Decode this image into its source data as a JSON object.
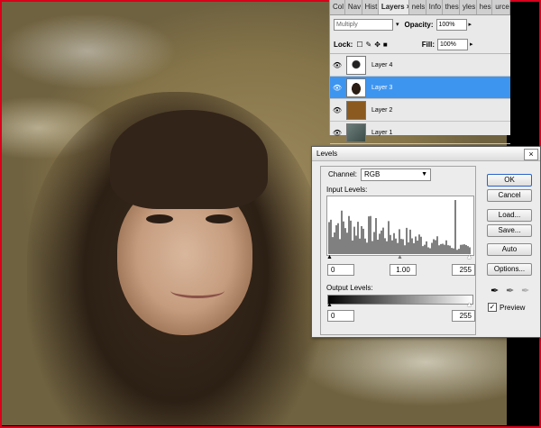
{
  "layers_panel": {
    "tabs": [
      "Col",
      "Nav",
      "Hist",
      "Layers",
      "nels",
      "Info",
      "thes",
      "yles",
      "hes",
      "urce"
    ],
    "active_tab": "Layers",
    "blend_mode": "Multiply",
    "opacity_label": "Opacity:",
    "opacity_value": "100%",
    "lock_label": "Lock:",
    "fill_label": "Fill:",
    "fill_value": "100%",
    "layers": [
      {
        "name": "Layer 4",
        "selected": false
      },
      {
        "name": "Layer 3",
        "selected": true
      },
      {
        "name": "Layer 2",
        "selected": false
      },
      {
        "name": "Layer 1",
        "selected": false
      }
    ]
  },
  "levels_dialog": {
    "title": "Levels",
    "channel_label": "Channel:",
    "channel_value": "RGB",
    "input_levels_label": "Input Levels:",
    "input_black": "0",
    "input_gamma": "1.00",
    "input_white": "255",
    "output_levels_label": "Output Levels:",
    "output_black": "0",
    "output_white": "255",
    "buttons": {
      "ok": "OK",
      "cancel": "Cancel",
      "load": "Load...",
      "save": "Save...",
      "auto": "Auto",
      "options": "Options..."
    },
    "preview_label": "Preview",
    "preview_checked": true
  },
  "colors": {
    "selection": "#3d95f0",
    "document_border": "#d9001b"
  }
}
